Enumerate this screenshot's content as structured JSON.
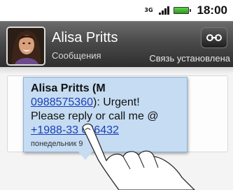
{
  "status_bar": {
    "network_type": "3G",
    "time": "18:00"
  },
  "header": {
    "contact_name": "Alisa Pritts",
    "subtitle": "Сообщения",
    "connection_status": "Связь установлена"
  },
  "message": {
    "sender": "Alisa Pritts (M",
    "sender_number": "0988575360",
    "text_after_number": "): Urgent!",
    "body_line": "Please reply or call me @",
    "phone_link": "+1988-33   656432",
    "timestamp": "понедельник     9"
  }
}
